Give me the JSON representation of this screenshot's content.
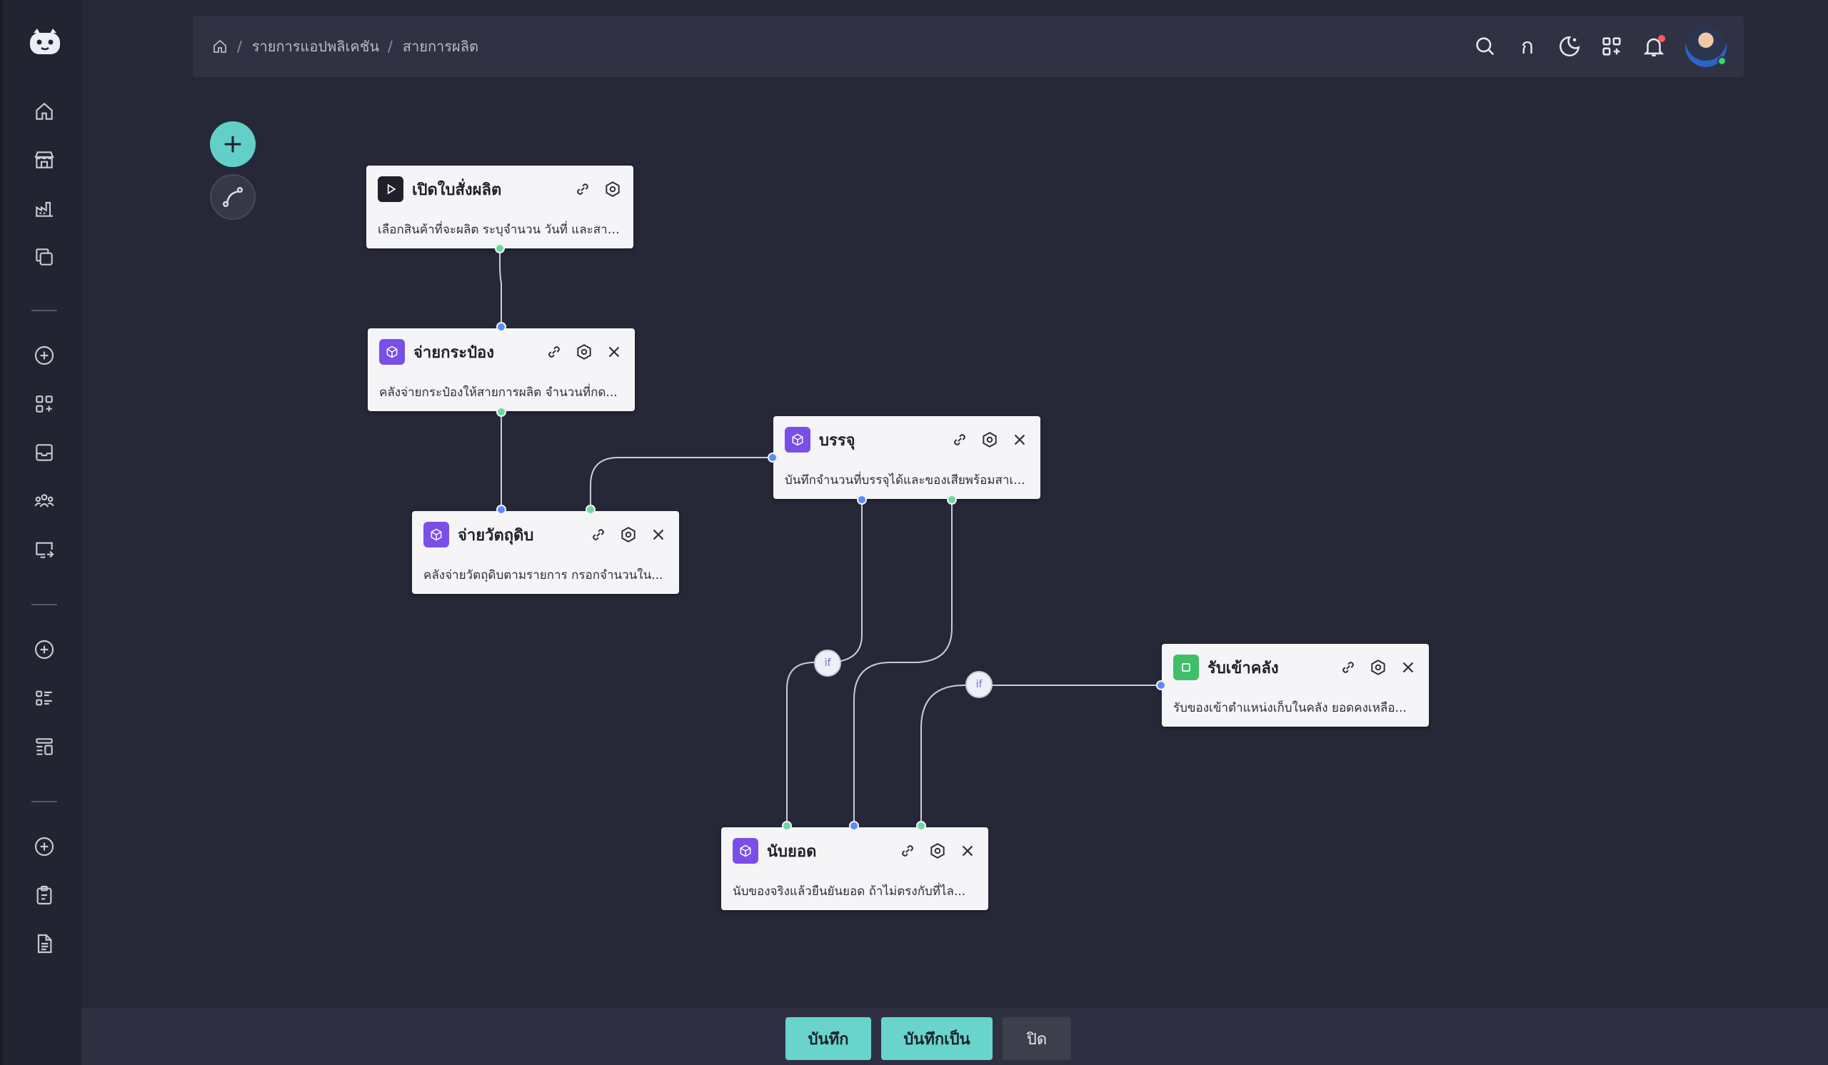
{
  "breadcrumb": {
    "home_icon": "home-icon",
    "items": [
      "รายการแอปพลิเคชัน",
      "สายการผลิต"
    ]
  },
  "header": {
    "lang_label": "ก",
    "icons": [
      "search-icon",
      "thai-language-icon",
      "moon-icon",
      "apps-add-icon",
      "bell-icon"
    ],
    "notification_dot_color": "#ff5a5a"
  },
  "sidebar": {
    "icons": [
      "home-icon",
      "store-icon",
      "factory-icon",
      "copy-icon",
      "plus-circle-icon",
      "grid-add-icon",
      "inbox-icon",
      "users-icon",
      "screen-share-icon",
      "plus-circle-icon",
      "list-icon",
      "layout-list-icon",
      "plus-circle-icon",
      "clipboard-icon",
      "document-icon"
    ]
  },
  "nodes": [
    {
      "id": "open_order",
      "title": "เปิดใบสั่งผลิต",
      "desc": "เลือกสินค้าที่จะผลิต ระบุจำนวน วันที่ และสาย...",
      "badge": "play-icon",
      "badge_color": "#1f2029"
    },
    {
      "id": "issue_cans",
      "title": "จ่ายกระป๋อง",
      "desc": "คลังจ่ายกระป๋องให้สายการผลิต จำนวนที่กด...",
      "badge": "cube-icon",
      "badge_color": "#7a4fe8"
    },
    {
      "id": "issue_raw",
      "title": "จ่ายวัตถุดิบ",
      "desc": "คลังจ่ายวัตถุดิบตามรายการ กรอกจำนวนใน...",
      "badge": "cube-icon",
      "badge_color": "#7a4fe8"
    },
    {
      "id": "pack",
      "title": "บรรจุ",
      "desc": "บันทึกจำนวนที่บรรจุได้และของเสียพร้อมสาเ...",
      "badge": "cube-icon",
      "badge_color": "#7a4fe8"
    },
    {
      "id": "receive",
      "title": "รับเข้าคลัง",
      "desc": "รับของเข้าตำแหน่งเก็บในคลัง ยอดคงเหลือ...",
      "badge": "square-icon",
      "badge_color": "#3fbf68"
    },
    {
      "id": "count",
      "title": "นับยอด",
      "desc": "นับของจริงแล้วยืนยันยอด ถ้าไม่ตรงกับที่ไล...",
      "badge": "cube-icon",
      "badge_color": "#7a4fe8"
    }
  ],
  "conditions": [
    "if",
    "if"
  ],
  "footer": {
    "save": "บันทึก",
    "save_as": "บันทึกเป็น",
    "close": "ปิด"
  },
  "colors": {
    "accent": "#62d0c8",
    "port_out": "#6fd6a0",
    "port_in": "#5b8cf5"
  }
}
